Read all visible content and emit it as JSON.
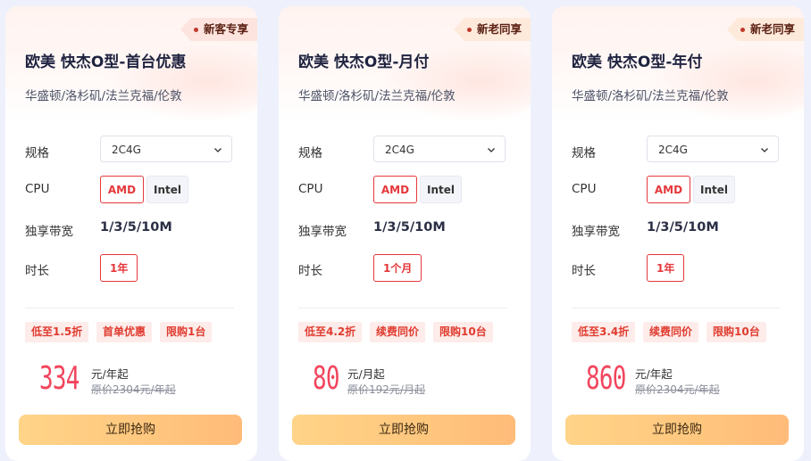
{
  "cards": [
    {
      "badge": "新客专享",
      "title": "欧美 快杰O型-首台优惠",
      "regions": "华盛顿/洛杉矶/法兰克福/伦敦",
      "spec_label": "规格",
      "spec_value": "2C4G",
      "cpu_label": "CPU",
      "cpu_options": [
        "AMD",
        "Intel"
      ],
      "bw_label": "独享带宽",
      "bw_value": "1/3/5/10M",
      "dur_label": "时长",
      "dur_value": "1年",
      "tags": [
        "低至1.5折",
        "首单优惠",
        "限购1台"
      ],
      "price": "334",
      "unit": "元/年起",
      "orig": "原价2304元/年起",
      "buy": "立即抢购"
    },
    {
      "badge": "新老同享",
      "title": "欧美 快杰O型-月付",
      "regions": "华盛顿/洛杉矶/法兰克福/伦敦",
      "spec_label": "规格",
      "spec_value": "2C4G",
      "cpu_label": "CPU",
      "cpu_options": [
        "AMD",
        "Intel"
      ],
      "bw_label": "独享带宽",
      "bw_value": "1/3/5/10M",
      "dur_label": "时长",
      "dur_value": "1个月",
      "tags": [
        "低至4.2折",
        "续费同价",
        "限购10台"
      ],
      "price": "80",
      "unit": "元/月起",
      "orig": "原价192元/月起",
      "buy": "立即抢购"
    },
    {
      "badge": "新老同享",
      "title": "欧美 快杰O型-年付",
      "regions": "华盛顿/洛杉矶/法兰克福/伦敦",
      "spec_label": "规格",
      "spec_value": "2C4G",
      "cpu_label": "CPU",
      "cpu_options": [
        "AMD",
        "Intel"
      ],
      "bw_label": "独享带宽",
      "bw_value": "1/3/5/10M",
      "dur_label": "时长",
      "dur_value": "1年",
      "tags": [
        "低至3.4折",
        "续费同价",
        "限购10台"
      ],
      "price": "860",
      "unit": "元/年起",
      "orig": "原价2304元/年起",
      "buy": "立即抢购"
    }
  ],
  "colors": {
    "accent_red": "#e5383b",
    "price_pink": "#f2455d",
    "button_gradient_start": "#ffd488",
    "button_gradient_end": "#ffbb79",
    "badge_bg": "#fde4df",
    "page_bg": "#eef1fb"
  },
  "icons": {
    "select_chevron": "chevron-down-icon",
    "badge_dot": "dot-icon"
  }
}
